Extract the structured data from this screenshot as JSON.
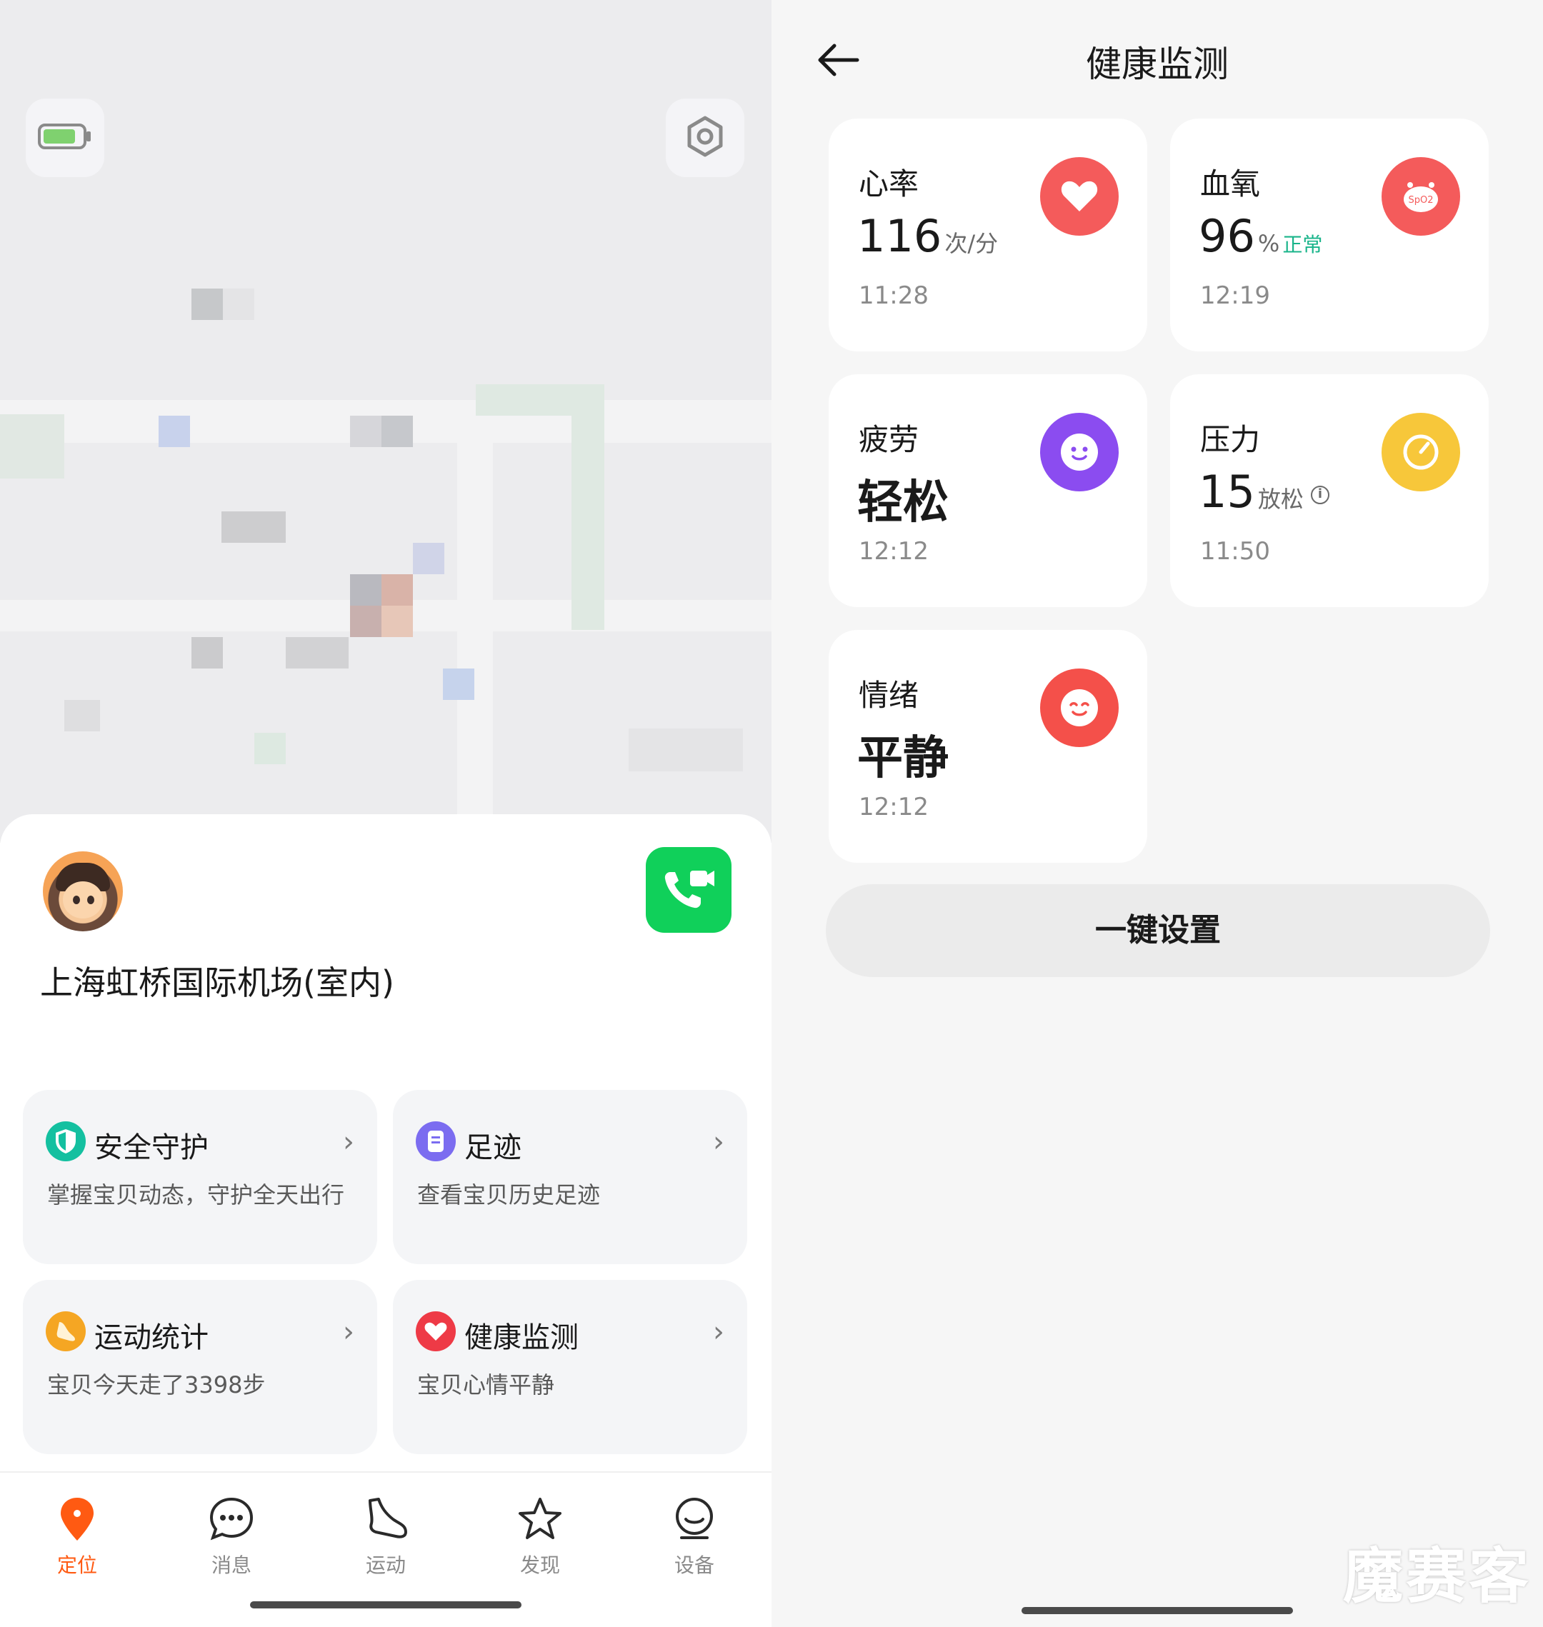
{
  "left": {
    "location": "上海虹桥国际机场(室内)",
    "cards": [
      {
        "title": "安全守护",
        "subtitle": "掌握宝贝动态，守护全天出行",
        "color": "#14c0a0",
        "icon": "shield-icon"
      },
      {
        "title": "足迹",
        "subtitle": "查看宝贝历史足迹",
        "color": "#7b6cf0",
        "icon": "footprint-icon"
      },
      {
        "title": "运动统计",
        "subtitle": "宝贝今天走了3398步",
        "color": "#f5a623",
        "icon": "sneaker-icon"
      },
      {
        "title": "健康监测",
        "subtitle": "宝贝心情平静",
        "color": "#ee3a46",
        "icon": "heart-icon"
      }
    ],
    "chevron": "›",
    "tabs": [
      {
        "label": "定位",
        "icon": "location-pin-icon",
        "active": true
      },
      {
        "label": "消息",
        "icon": "chat-icon",
        "active": false
      },
      {
        "label": "运动",
        "icon": "sneaker-icon",
        "active": false
      },
      {
        "label": "发现",
        "icon": "star-icon",
        "active": false
      },
      {
        "label": "设备",
        "icon": "device-icon",
        "active": false
      }
    ],
    "colors": {
      "accent": "#ff5a12",
      "call": "#10d05a"
    }
  },
  "right": {
    "title": "健康监测",
    "metrics": {
      "heart_rate": {
        "label": "心率",
        "value": "116",
        "unit": "次/分",
        "time": "11:28",
        "color": "#f45b5b"
      },
      "spo2": {
        "label": "血氧",
        "value": "96",
        "unit": "%",
        "status": "正常",
        "time": "12:19",
        "color": "#f45b5b",
        "icon_text": "SpO2"
      },
      "fatigue": {
        "label": "疲劳",
        "value": "轻松",
        "time": "12:12",
        "color": "#8b4cf0"
      },
      "stress": {
        "label": "压力",
        "value": "15",
        "unit": "放松",
        "info": "i",
        "time": "11:50",
        "color": "#f7c73a"
      },
      "mood": {
        "label": "情绪",
        "value": "平静",
        "time": "12:12",
        "color": "#f4504a"
      }
    },
    "one_click_label": "一键设置",
    "watermark": "魔赛客"
  }
}
